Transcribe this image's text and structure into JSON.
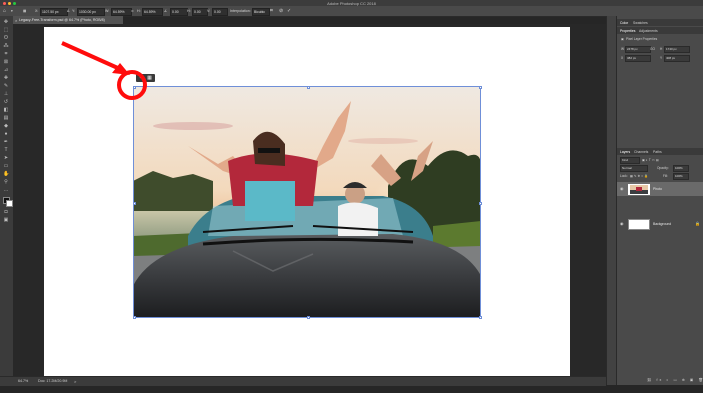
{
  "app": {
    "title": "Adobe Photoshop CC 2018"
  },
  "window_controls": {
    "close": "#ff5f57",
    "minimize": "#febc2e",
    "zoom": "#28c840"
  },
  "options_bar": {
    "x_value": "1107.50 px",
    "y_value": "1030.00 px",
    "w_value": "64.59%",
    "h_value": "64.59%",
    "angle_value": "0.00",
    "h_skew": "0.00",
    "v_skew": "0.00",
    "interpolation_label": "Interpolation:",
    "interpolation_value": "Bicubic",
    "cancel_icon": "cancel-icon",
    "commit_icon": "commit-icon"
  },
  "document": {
    "tab_label": "Legacy-Free-Transform.psd @ 64.7% (Photo, RGB/8)",
    "close_glyph": "×"
  },
  "status_bar": {
    "zoom": "64.7%",
    "doc_size": "Doc: 17.2M/20.9M",
    "arrow": ">"
  },
  "panels": {
    "top_tabs": [
      "Color",
      "Swatches"
    ],
    "props_tabs": [
      "Properties",
      "Adjustments"
    ],
    "props_title": "Pixel Layer Properties",
    "w_label": "W",
    "w_value": "2478 px",
    "go_label": "GO",
    "h_label": "H",
    "h_value": "1740 px",
    "x_label": "X",
    "x_value": "382 px",
    "y_label": "Y",
    "y_value": "408 px",
    "layers_tabs": [
      "Layers",
      "Channels",
      "Paths"
    ],
    "kind_label": "Kind",
    "blend_mode": "Normal",
    "opacity_label": "Opacity:",
    "opacity_value": "100%",
    "lock_label": "Lock:",
    "fill_label": "Fill:",
    "fill_value": "100%",
    "layers": [
      {
        "name": "Photo",
        "selected": true
      },
      {
        "name": "Background",
        "selected": false
      }
    ]
  },
  "colors": {
    "accent_blue": "#6f8fd8",
    "annotation_red": "#ff0c0c"
  }
}
